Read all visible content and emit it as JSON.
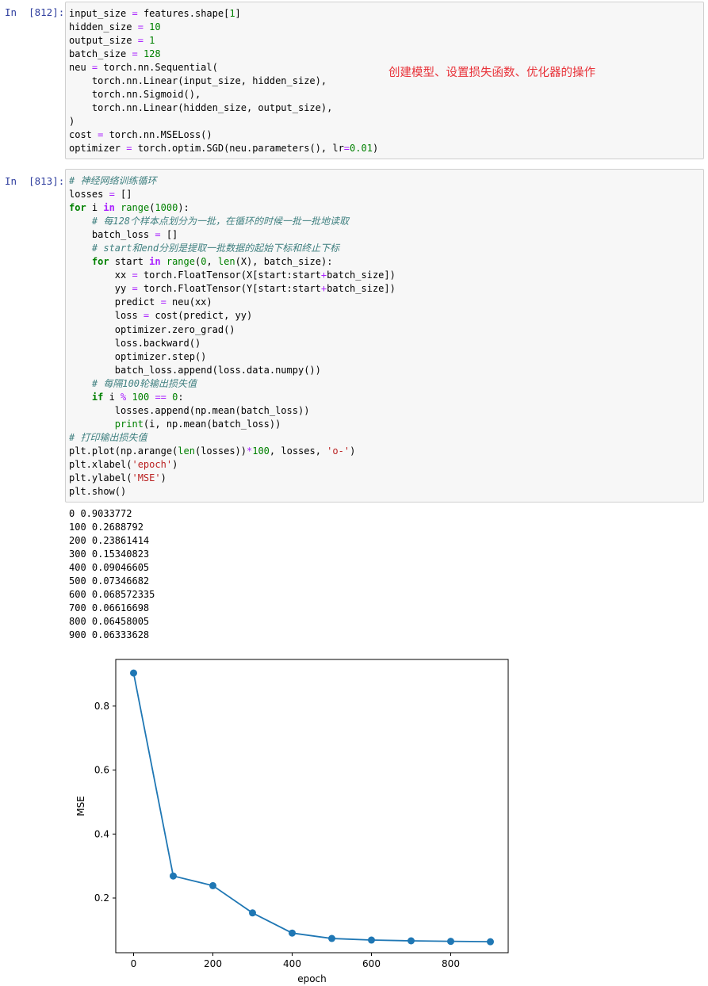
{
  "cells": [
    {
      "prompt": "In  [812]:",
      "annotation": "创建模型、设置损失函数、优化器的操作",
      "lines": [
        [
          [
            "input_size ",
            ""
          ],
          [
            "=",
            "o"
          ],
          [
            " features.shape[",
            ""
          ],
          [
            "1",
            "n"
          ],
          [
            "]",
            ""
          ]
        ],
        [
          [
            "hidden_size ",
            ""
          ],
          [
            "=",
            "o"
          ],
          [
            " ",
            ""
          ],
          [
            "10",
            "n"
          ]
        ],
        [
          [
            "output_size ",
            ""
          ],
          [
            "=",
            "o"
          ],
          [
            " ",
            ""
          ],
          [
            "1",
            "n"
          ]
        ],
        [
          [
            "batch_size ",
            ""
          ],
          [
            "=",
            "o"
          ],
          [
            " ",
            ""
          ],
          [
            "128",
            "n"
          ]
        ],
        [
          [
            "neu ",
            ""
          ],
          [
            "=",
            "o"
          ],
          [
            " torch.nn.Sequential(",
            ""
          ]
        ],
        [
          [
            "    torch.nn.Linear(input_size, hidden_size),",
            ""
          ]
        ],
        [
          [
            "    torch.nn.Sigmoid(),",
            ""
          ]
        ],
        [
          [
            "    torch.nn.Linear(hidden_size, output_size),",
            ""
          ]
        ],
        [
          [
            ")",
            ""
          ]
        ],
        [
          [
            "cost ",
            ""
          ],
          [
            "=",
            "o"
          ],
          [
            " torch.nn.MSELoss()",
            ""
          ]
        ],
        [
          [
            "optimizer ",
            ""
          ],
          [
            "=",
            "o"
          ],
          [
            " torch.optim.SGD(neu.parameters(), lr",
            ""
          ],
          [
            "=",
            "o"
          ],
          [
            "0.01",
            "n"
          ],
          [
            ")",
            ""
          ]
        ]
      ]
    },
    {
      "prompt": "In  [813]:",
      "lines": [
        [
          [
            "# 神经网络训练循环",
            "c"
          ]
        ],
        [
          [
            "losses ",
            ""
          ],
          [
            "=",
            "o"
          ],
          [
            " []",
            ""
          ]
        ],
        [
          [
            "for",
            "k"
          ],
          [
            " i ",
            ""
          ],
          [
            "in",
            "ow"
          ],
          [
            " ",
            ""
          ],
          [
            "range",
            "b"
          ],
          [
            "(",
            ""
          ],
          [
            "1000",
            "n"
          ],
          [
            "):",
            ""
          ]
        ],
        [
          [
            "    ",
            ""
          ],
          [
            "# 每128个样本点划分为一批，在循环的时候一批一批地读取",
            "c"
          ]
        ],
        [
          [
            "    batch_loss ",
            ""
          ],
          [
            "=",
            "o"
          ],
          [
            " []",
            ""
          ]
        ],
        [
          [
            "    ",
            ""
          ],
          [
            "# start和end分别是提取一批数据的起始下标和终止下标",
            "c"
          ]
        ],
        [
          [
            "    ",
            ""
          ],
          [
            "for",
            "k"
          ],
          [
            " start ",
            ""
          ],
          [
            "in",
            "ow"
          ],
          [
            " ",
            ""
          ],
          [
            "range",
            "b"
          ],
          [
            "(",
            ""
          ],
          [
            "0",
            "n"
          ],
          [
            ", ",
            ""
          ],
          [
            "len",
            "b"
          ],
          [
            "(X), batch_size):",
            ""
          ]
        ],
        [
          [
            "        xx ",
            ""
          ],
          [
            "=",
            "o"
          ],
          [
            " torch.FloatTensor(X[start:start",
            ""
          ],
          [
            "+",
            "o"
          ],
          [
            "batch_size])",
            ""
          ]
        ],
        [
          [
            "        yy ",
            ""
          ],
          [
            "=",
            "o"
          ],
          [
            " torch.FloatTensor(Y[start:start",
            ""
          ],
          [
            "+",
            "o"
          ],
          [
            "batch_size])",
            ""
          ]
        ],
        [
          [
            "        predict ",
            ""
          ],
          [
            "=",
            "o"
          ],
          [
            " neu(xx)",
            ""
          ]
        ],
        [
          [
            "        loss ",
            ""
          ],
          [
            "=",
            "o"
          ],
          [
            " cost(predict, yy)",
            ""
          ]
        ],
        [
          [
            "        optimizer.zero_grad()",
            ""
          ]
        ],
        [
          [
            "        loss.backward()",
            ""
          ]
        ],
        [
          [
            "        optimizer.step()",
            ""
          ]
        ],
        [
          [
            "        batch_loss.append(loss.data.numpy())",
            ""
          ]
        ],
        [
          [
            "    ",
            ""
          ],
          [
            "# 每隔100轮输出损失值",
            "c"
          ]
        ],
        [
          [
            "    ",
            ""
          ],
          [
            "if",
            "k"
          ],
          [
            " i ",
            ""
          ],
          [
            "%",
            "o"
          ],
          [
            " ",
            ""
          ],
          [
            "100",
            "n"
          ],
          [
            " ",
            ""
          ],
          [
            "==",
            "o"
          ],
          [
            " ",
            ""
          ],
          [
            "0",
            "n"
          ],
          [
            ":",
            ""
          ]
        ],
        [
          [
            "        losses.append(np.mean(batch_loss))",
            ""
          ]
        ],
        [
          [
            "        ",
            ""
          ],
          [
            "print",
            "b"
          ],
          [
            "(i, np.mean(batch_loss))",
            ""
          ]
        ],
        [
          [
            "# 打印输出损失值",
            "c"
          ]
        ],
        [
          [
            "plt.plot(np.arange(",
            ""
          ],
          [
            "len",
            "b"
          ],
          [
            "(losses))",
            ""
          ],
          [
            "*",
            "o"
          ],
          [
            "100",
            "n"
          ],
          [
            ", losses, ",
            ""
          ],
          [
            "'o-'",
            "s"
          ],
          [
            ")",
            ""
          ]
        ],
        [
          [
            "plt.xlabel(",
            ""
          ],
          [
            "'epoch'",
            "s"
          ],
          [
            ")",
            ""
          ]
        ],
        [
          [
            "plt.ylabel(",
            ""
          ],
          [
            "'MSE'",
            "s"
          ],
          [
            ")",
            ""
          ]
        ],
        [
          [
            "plt.show()",
            ""
          ]
        ]
      ]
    }
  ],
  "output_lines": [
    "0 0.9033772",
    "100 0.2688792",
    "200 0.23861414",
    "300 0.15340823",
    "400 0.09046605",
    "500 0.07346682",
    "600 0.068572335",
    "700 0.06616698",
    "800 0.06458005",
    "900 0.06333628"
  ],
  "chart_data": {
    "type": "line",
    "x": [
      0,
      100,
      200,
      300,
      400,
      500,
      600,
      700,
      800,
      900
    ],
    "series": [
      {
        "values": [
          0.9033772,
          0.2688792,
          0.23861414,
          0.15340823,
          0.09046605,
          0.07346682,
          0.068572335,
          0.06616698,
          0.06458005,
          0.06333628
        ]
      }
    ],
    "xlabel": "epoch",
    "ylabel": "MSE",
    "xlim": [
      -45,
      945
    ],
    "ylim": [
      0.029,
      0.9458
    ],
    "xticks": [
      0,
      200,
      400,
      600,
      800
    ],
    "xtick_labels": [
      "0",
      "200",
      "400",
      "600",
      "800"
    ],
    "yticks": [
      0.2,
      0.4,
      0.6,
      0.8
    ],
    "ytick_labels": [
      "0.2",
      "0.4",
      "0.6",
      "0.8"
    ],
    "marker": "o",
    "grid": false,
    "color": "#1f77b4"
  }
}
